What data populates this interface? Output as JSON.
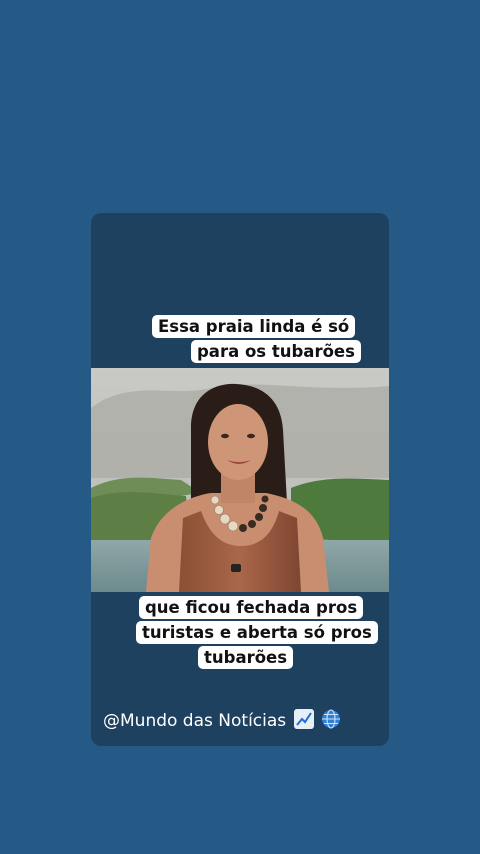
{
  "captions": {
    "top": [
      "Essa praia linda é só",
      "para os tubarões"
    ],
    "bottom": [
      "que ficou fechada pros",
      "turistas e aberta só pros",
      "tubarões"
    ]
  },
  "footer": {
    "handle": "@Mundo das Notícias"
  },
  "icons": [
    "chart-increasing-icon",
    "globe-icon"
  ],
  "colors": {
    "background": "#245a85",
    "card": "#1f4160",
    "caption_bg": "#ffffff"
  }
}
